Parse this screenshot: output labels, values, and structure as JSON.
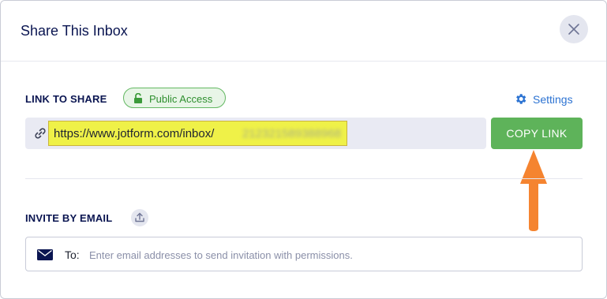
{
  "dialog": {
    "title": "Share This Inbox",
    "close_icon": "close-icon"
  },
  "link_section": {
    "label": "LINK TO SHARE",
    "badge": {
      "text": "Public Access",
      "icon": "lock-icon",
      "color": "#5eb35a"
    },
    "settings": {
      "text": "Settings",
      "icon": "gear-icon",
      "color": "#2c73d2"
    },
    "link_icon": "link-icon",
    "url_prefix": "https://www.jotform.com/inbox/",
    "url_id_blurred": "212321589388968",
    "copy_button": {
      "label": "COPY LINK",
      "color": "#5eb35a"
    }
  },
  "annotation": {
    "icon": "arrow-up-icon",
    "color": "#f58430"
  },
  "invite_section": {
    "label": "INVITE BY EMAIL",
    "upload_icon": "upload-icon",
    "mail_icon": "envelope-icon",
    "to_label": "To:",
    "placeholder": "Enter email addresses to send invitation with permissions.",
    "value": ""
  }
}
